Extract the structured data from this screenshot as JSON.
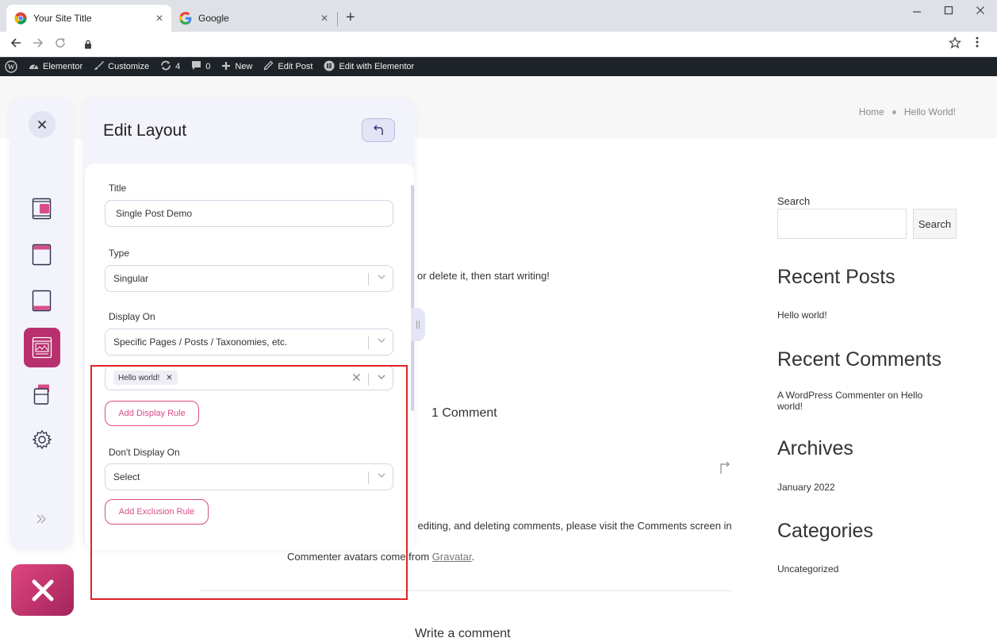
{
  "browser": {
    "tabs": [
      {
        "title": "Your Site Title",
        "favicon": "chrome-icon"
      },
      {
        "title": "Google",
        "favicon": "google-icon"
      }
    ],
    "close_glyph": "✕",
    "new_tab_glyph": "+"
  },
  "wp_admin_bar": {
    "items": [
      {
        "label": "",
        "icon": "wordpress-icon"
      },
      {
        "label": "Elementor",
        "icon": "dashboard-icon"
      },
      {
        "label": "Customize",
        "icon": "brush-icon"
      },
      {
        "label": "4",
        "icon": "updates-icon"
      },
      {
        "label": "0",
        "icon": "comments-icon"
      },
      {
        "label": "New",
        "icon": "plus-icon"
      },
      {
        "label": "Edit Post",
        "icon": "pencil-icon"
      },
      {
        "label": "Edit with Elementor",
        "icon": "elementor-icon"
      }
    ]
  },
  "site": {
    "breadcrumb": {
      "home": "Home",
      "current": "Hello World!"
    },
    "post_excerpt": "or delete it, then start writing!",
    "comments_heading": "1 Comment",
    "comment_text": "ng, editing, and deleting comments, please visit the Comments screen in",
    "avatars_text": "Commenter avatars come from ",
    "avatars_link": "Gravatar",
    "avatars_suffix": ".",
    "write_comment": "Write a comment"
  },
  "sidebar": {
    "search_label": "Search",
    "search_button": "Search",
    "recent_posts_title": "Recent Posts",
    "recent_posts": [
      "Hello world!"
    ],
    "recent_comments_title": "Recent Comments",
    "recent_comment": "A WordPress Commenter on Hello world!",
    "archives_title": "Archives",
    "archives": [
      "January 2022"
    ],
    "categories_title": "Categories",
    "categories": [
      "Uncategorized"
    ]
  },
  "builder": {
    "panel_title": "Edit Layout",
    "title_label": "Title",
    "title_value": "Single Post Demo",
    "type_label": "Type",
    "type_value": "Singular",
    "display_on_label": "Display On",
    "display_on_value": "Specific Pages / Posts / Taxonomies, etc.",
    "display_chip": "Hello world!",
    "add_display_rule": "Add Display Rule",
    "dont_display_label": "Don't Display On",
    "dont_display_value": "Select",
    "add_exclusion_rule": "Add Exclusion Rule",
    "accent_color": "#b9306e",
    "highlight_color": "#e02424"
  }
}
